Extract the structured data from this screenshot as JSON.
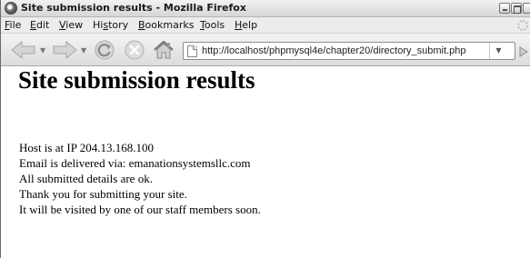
{
  "window": {
    "title": "Site submission results - Mozilla Firefox"
  },
  "menu": [
    {
      "accel": "F",
      "rest": "ile"
    },
    {
      "accel": "E",
      "rest": "dit"
    },
    {
      "accel": "V",
      "rest": "iew"
    },
    {
      "pre": "Hi",
      "accel": "s",
      "rest": "tory"
    },
    {
      "accel": "B",
      "rest": "ookmarks"
    },
    {
      "accel": "T",
      "rest": "ools"
    },
    {
      "accel": "H",
      "rest": "elp"
    }
  ],
  "navigation": {
    "url": "http://localhost/phpmysql4e/chapter20/directory_submit.php"
  },
  "page": {
    "heading": "Site submission results",
    "lines": [
      "Host is at IP 204.13.168.100",
      "Email is delivered via: emanationsystemsllc.com",
      "All submitted details are ok.",
      "Thank you for submitting your site.",
      "It will be visited by one of our staff members soon."
    ]
  },
  "icons": {
    "app": "firefox-icon",
    "back": "back-arrow-icon",
    "forward": "forward-arrow-icon",
    "reload": "reload-icon",
    "stop": "stop-icon",
    "home": "home-icon",
    "page": "page-icon",
    "go": "go-arrow-icon"
  }
}
